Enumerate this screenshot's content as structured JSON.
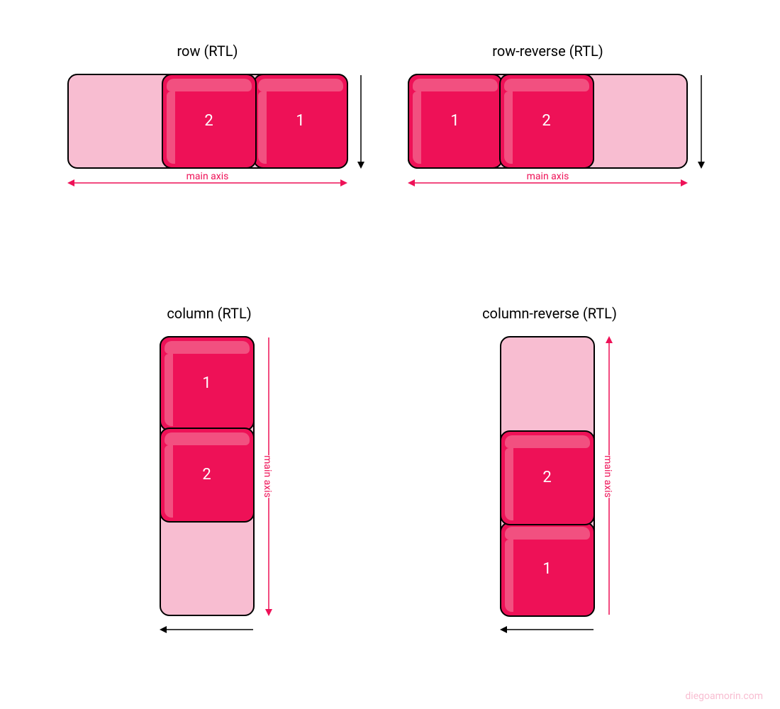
{
  "colors": {
    "accent": "#ee1157",
    "lightBg": "#f8bdd1",
    "itemHighlight": "#f25080",
    "border": "#000000"
  },
  "watermark": "diegoamorin.com",
  "axisLabel": "main axis",
  "panels": [
    {
      "id": "row",
      "title": "row (RTL)",
      "direction": "row",
      "orientation": "horizontal",
      "items": [
        "1",
        "2"
      ],
      "mainAxis": "horizontal-double",
      "crossAxis": "down"
    },
    {
      "id": "row-reverse",
      "title": "row-reverse (RTL)",
      "direction": "row-reverse",
      "orientation": "horizontal",
      "items": [
        "1",
        "2"
      ],
      "mainAxis": "horizontal-double",
      "crossAxis": "down"
    },
    {
      "id": "column",
      "title": "column (RTL)",
      "direction": "column",
      "orientation": "vertical",
      "items": [
        "1",
        "2"
      ],
      "mainAxis": "vertical-down",
      "crossAxis": "left"
    },
    {
      "id": "column-reverse",
      "title": "column-reverse (RTL)",
      "direction": "column-reverse",
      "orientation": "vertical",
      "items": [
        "1",
        "2"
      ],
      "mainAxis": "vertical-up",
      "crossAxis": "left"
    }
  ]
}
